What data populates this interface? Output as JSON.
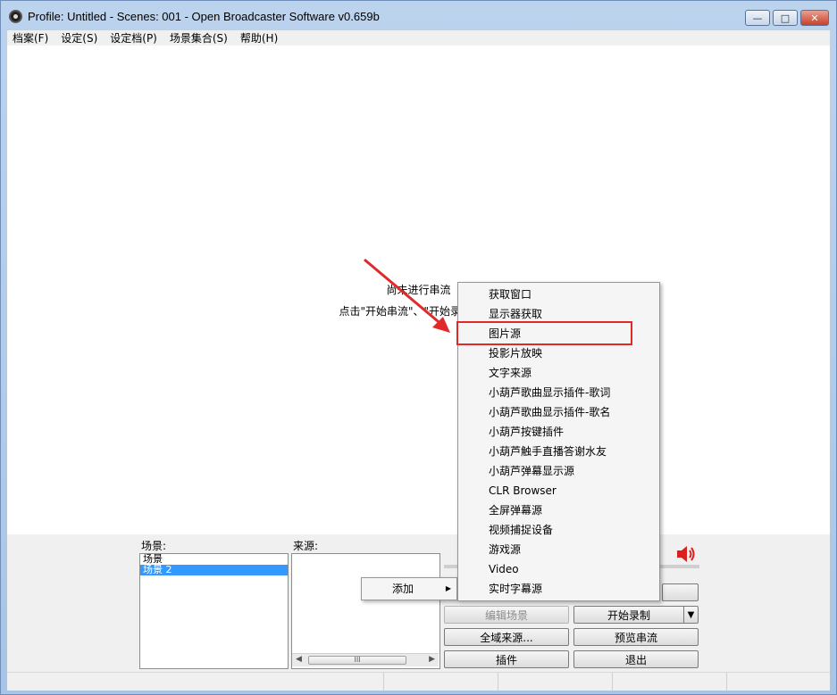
{
  "window": {
    "title": "Profile: Untitled - Scenes: 001 - Open Broadcaster Software v0.659b",
    "minimize_icon": "minimize-icon",
    "maximize_icon": "maximize-icon",
    "close_icon": "close-icon"
  },
  "menubar": {
    "items": [
      {
        "label": "档案(F)"
      },
      {
        "label": "设定(S)"
      },
      {
        "label": "设定档(P)"
      },
      {
        "label": "场景集合(S)"
      },
      {
        "label": "帮助(H)"
      }
    ]
  },
  "preview": {
    "line1": "尚未进行串流",
    "line2": "点击\"开始串流\"、\"开始录制\"或者"
  },
  "scenes": {
    "label": "场景:",
    "items": [
      {
        "label": "场景",
        "selected": false
      },
      {
        "label": "场景 2",
        "selected": true
      }
    ]
  },
  "sources": {
    "label": "来源:"
  },
  "context_menu": {
    "add_label": "添加",
    "add_arrow": "▶"
  },
  "add_submenu": {
    "items": [
      {
        "label": "获取窗口"
      },
      {
        "label": "显示器获取"
      },
      {
        "label": "图片源"
      },
      {
        "label": "投影片放映"
      },
      {
        "label": "文字来源"
      },
      {
        "label": "小葫芦歌曲显示插件-歌词"
      },
      {
        "label": "小葫芦歌曲显示插件-歌名"
      },
      {
        "label": "小葫芦按键插件"
      },
      {
        "label": "小葫芦触手直播答谢水友"
      },
      {
        "label": "小葫芦弹幕显示源"
      },
      {
        "label": "CLR Browser"
      },
      {
        "label": "全屏弹幕源"
      },
      {
        "label": "视频捕捉设备"
      },
      {
        "label": "游戏源"
      },
      {
        "label": "Video"
      },
      {
        "label": "实时字幕源"
      }
    ],
    "highlighted_index": 2
  },
  "buttons": {
    "edit_scene": "编辑场景",
    "start_recording": "开始录制",
    "dropdown_arrow": "▼",
    "global_sources": "全域来源...",
    "preview_stream": "预览串流",
    "plugins": "插件",
    "exit": "退出"
  },
  "scrollbar": {
    "left": "◀",
    "right": "▶",
    "thumb": "III"
  },
  "colors": {
    "highlight": "#e02a2a",
    "selection": "#3399ff",
    "speaker": "#d9201c"
  }
}
